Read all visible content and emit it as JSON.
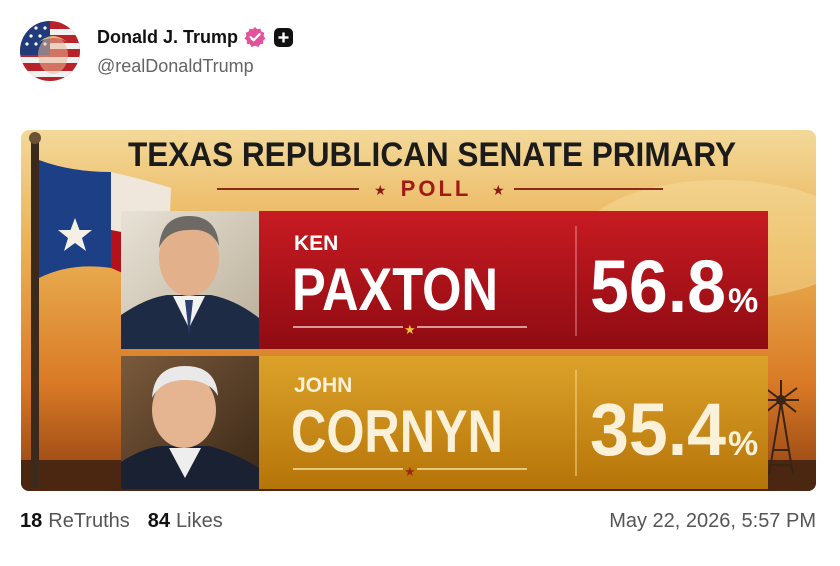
{
  "author": {
    "display_name": "Donald J. Trump",
    "handle": "@realDonaldTrump",
    "verified_icon": "verified-badge-icon",
    "plus_icon": "plus-badge-icon",
    "accent": "#e2539b"
  },
  "graphic": {
    "title": "TEXAS REPUBLICAN SENATE PRIMARY",
    "subtitle": "POLL",
    "rows": [
      {
        "first": "KEN",
        "last": "PAXTON",
        "value": "56.8",
        "unit": "%",
        "color": "#b1121a"
      },
      {
        "first": "JOHN",
        "last": "CORNYN",
        "value": "35.4",
        "unit": "%",
        "color": "#c98a0f"
      }
    ]
  },
  "footer": {
    "retruths_count": "18",
    "retruths_label": "ReTruths",
    "likes_count": "84",
    "likes_label": "Likes",
    "timestamp": "May 22, 2026, 5:57 PM"
  }
}
